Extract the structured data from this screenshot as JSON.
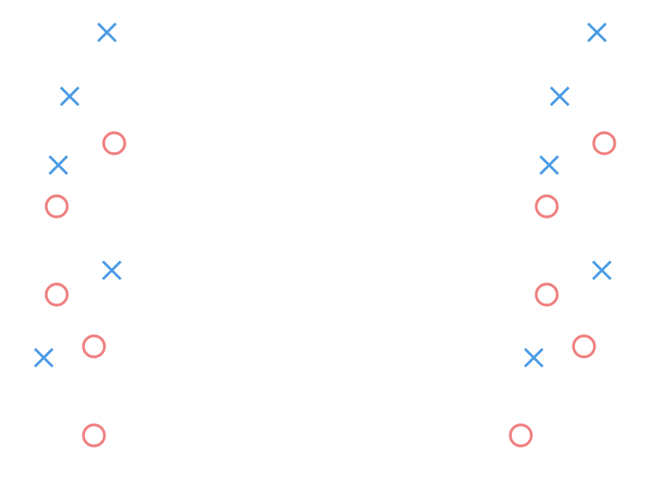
{
  "colors": {
    "background": "#ffffff",
    "x_marker": "#4a9be6",
    "o_marker": "#f08080"
  },
  "panels": [
    {
      "name": "left",
      "markers": [
        {
          "symbol": "x",
          "row": 1
        },
        {
          "symbol": "x",
          "row": 2
        },
        {
          "symbol": "o",
          "row": 3
        },
        {
          "symbol": "x",
          "row": 4
        },
        {
          "symbol": "o",
          "row": 5
        },
        {
          "symbol": "x",
          "row": 6
        },
        {
          "symbol": "o",
          "row": 7
        },
        {
          "symbol": "o",
          "row": 8
        },
        {
          "symbol": "x",
          "row": 9
        },
        {
          "symbol": "o",
          "row": 10
        }
      ]
    },
    {
      "name": "right",
      "markers": [
        {
          "symbol": "x",
          "row": 1
        },
        {
          "symbol": "x",
          "row": 2
        },
        {
          "symbol": "o",
          "row": 3
        },
        {
          "symbol": "x",
          "row": 4
        },
        {
          "symbol": "o",
          "row": 5
        },
        {
          "symbol": "x",
          "row": 6
        },
        {
          "symbol": "o",
          "row": 7
        },
        {
          "symbol": "o",
          "row": 8
        },
        {
          "symbol": "x",
          "row": 9
        },
        {
          "symbol": "o",
          "row": 10
        }
      ]
    }
  ]
}
